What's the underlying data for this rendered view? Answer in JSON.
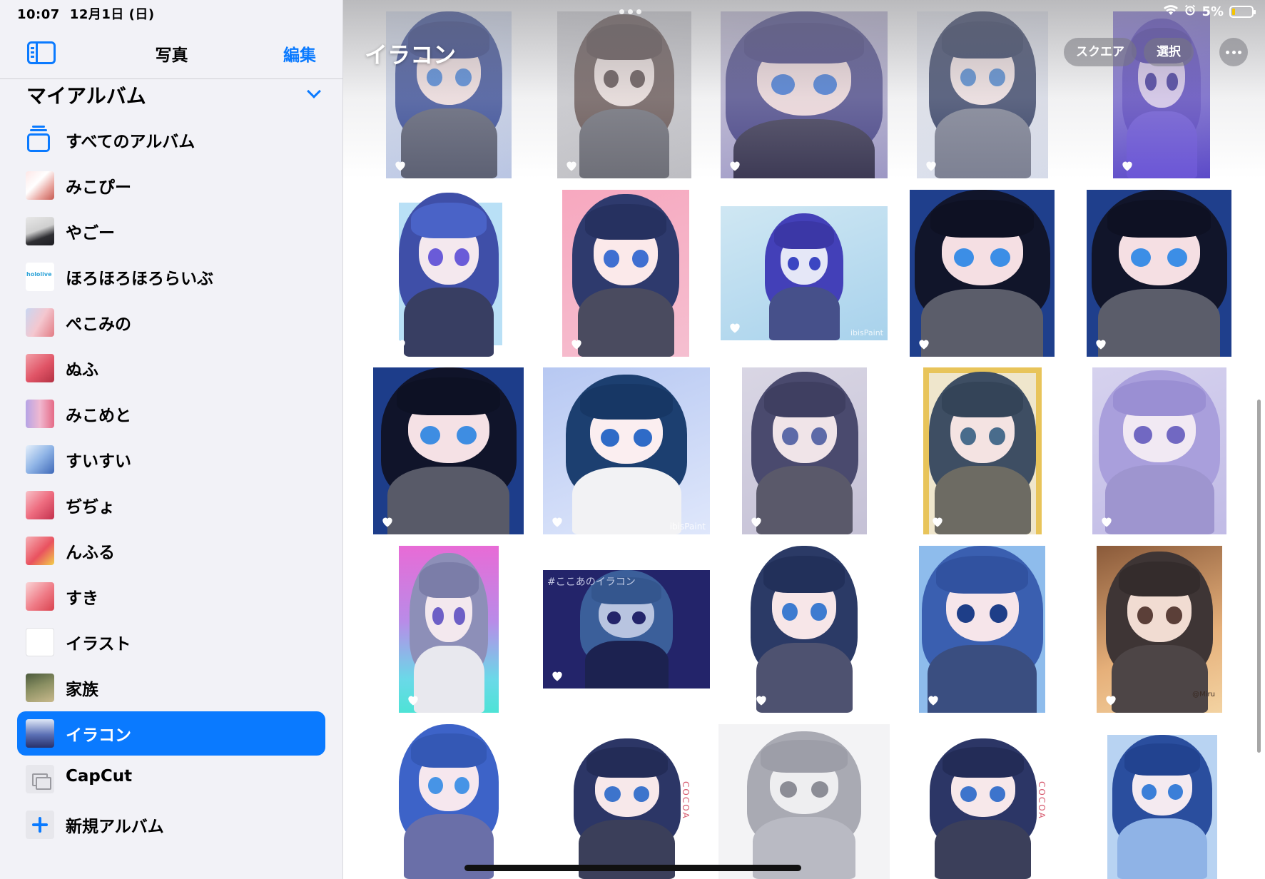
{
  "status": {
    "time": "10:07",
    "date": "12月1日 (日)",
    "battery": "5%"
  },
  "sidebar": {
    "title": "写真",
    "edit": "編集",
    "section": "マイアルバム",
    "items": [
      {
        "label": "すべてのアルバム",
        "icon": "album-stack-icon"
      },
      {
        "label": "みこぴー"
      },
      {
        "label": "やごー"
      },
      {
        "label": "ほろほろほろらいぶ",
        "thumb_text": "hololive"
      },
      {
        "label": "ぺこみの"
      },
      {
        "label": "ぬふ"
      },
      {
        "label": "みこめと"
      },
      {
        "label": "すいすい"
      },
      {
        "label": "ぢぢょ"
      },
      {
        "label": "んふる"
      },
      {
        "label": "すき"
      },
      {
        "label": "イラスト"
      },
      {
        "label": "家族"
      },
      {
        "label": "イラコン",
        "selected": true
      },
      {
        "label": "CapCut",
        "icon": "capcut-icon"
      },
      {
        "label": "新規アルバム",
        "icon": "plus-icon"
      }
    ]
  },
  "main": {
    "album_title": "イラコン",
    "buttons": {
      "square": "スクエア",
      "select": "選択"
    },
    "overlay_texts": [
      "#ここあのイラコン",
      "COCOA",
      "ibisPaint",
      "@Miru"
    ]
  },
  "colors": {
    "accent": "#0a7aff",
    "sidebar_bg": "#f2f2f7",
    "selected_text": "#ffffff"
  }
}
